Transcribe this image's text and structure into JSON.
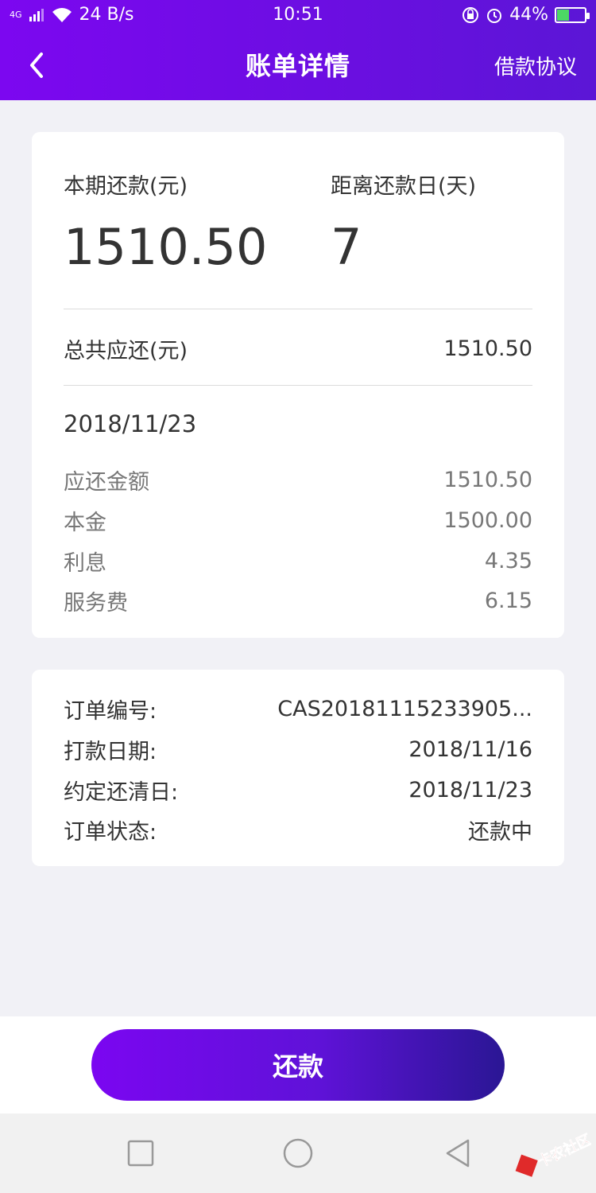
{
  "status_bar": {
    "network": "4G",
    "speed": "24 B/s",
    "time": "10:51",
    "battery": "44%",
    "battery_level": 0.44
  },
  "navbar": {
    "title": "账单详情",
    "right_link": "借款协议"
  },
  "summary": {
    "current_label": "本期还款(元)",
    "current_value": "1510.50",
    "days_label": "距离还款日(天)",
    "days_value": "7",
    "total_label": "总共应还(元)",
    "total_value": "1510.50",
    "due_date": "2018/11/23",
    "items": [
      {
        "label": "应还金额",
        "value": "1510.50"
      },
      {
        "label": "本金",
        "value": "1500.00"
      },
      {
        "label": "利息",
        "value": "4.35"
      },
      {
        "label": "服务费",
        "value": "6.15"
      }
    ]
  },
  "order": [
    {
      "label": "订单编号:",
      "value": "CAS20181115233905..."
    },
    {
      "label": "打款日期:",
      "value": "2018/11/16"
    },
    {
      "label": "约定还清日:",
      "value": "2018/11/23"
    },
    {
      "label": "订单状态:",
      "value": "还款中"
    }
  ],
  "pay_button": "还款",
  "watermark": "卡农社区",
  "colors": {
    "accent": "#7b06f1",
    "accent_dark": "#2a1694",
    "background": "#f1f1f6"
  }
}
